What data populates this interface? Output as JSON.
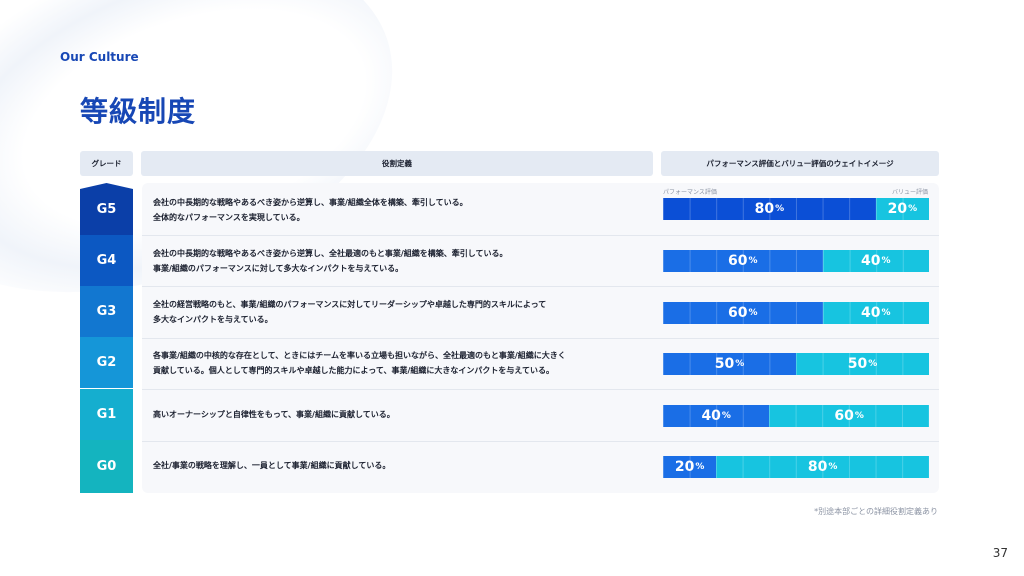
{
  "section_label": "Our Culture",
  "title": "等級制度",
  "headers": {
    "grade": "グレード",
    "role": "役割定義",
    "weight": "パフォーマンス評価とバリュー評価のウェイトイメージ"
  },
  "subheaders": {
    "performance": "パフォーマンス評価",
    "value": "バリュー評価"
  },
  "rows": [
    {
      "grade": "G5",
      "role": "会社の中長期的な戦略やあるべき姿から逆算し、事業/組織全体を構築、牽引している。\n全体的なパフォーマンスを実現している。",
      "performance": 80,
      "value": 20,
      "performance_label": "80",
      "value_label": "20"
    },
    {
      "grade": "G4",
      "role": "会社の中長期的な戦略やあるべき姿から逆算し、全社最適のもと事業/組織を構築、牽引している。\n事業/組織のパフォーマンスに対して多大なインパクトを与えている。",
      "performance": 60,
      "value": 40,
      "performance_label": "60",
      "value_label": "40"
    },
    {
      "grade": "G3",
      "role": "全社の経営戦略のもと、事業/組織のパフォーマンスに対してリーダーシップや卓越した専門的スキルによって\n多大なインパクトを与えている。",
      "performance": 60,
      "value": 40,
      "performance_label": "60",
      "value_label": "40"
    },
    {
      "grade": "G2",
      "role": "各事業/組織の中核的な存在として、ときにはチームを率いる立場も担いながら、全社最適のもと事業/組織に大きく\n貢献している。個人として専門的スキルや卓越した能力によって、事業/組織に大きなインパクトを与えている。",
      "performance": 50,
      "value": 50,
      "performance_label": "50",
      "value_label": "50"
    },
    {
      "grade": "G1",
      "role": "高いオーナーシップと自律性をもって、事業/組織に貢献している。",
      "performance": 40,
      "value": 60,
      "performance_label": "40",
      "value_label": "60"
    },
    {
      "grade": "G0",
      "role": "全社/事業の戦略を理解し、一員として事業/組織に貢献している。",
      "performance": 20,
      "value": 80,
      "performance_label": "20",
      "value_label": "80"
    }
  ],
  "percent_symbol": "%",
  "footnote": "*別途本部ごとの詳細役割定義あり",
  "page_number": "37",
  "colors": {
    "brand": "#1747b5",
    "performance": "#0b4fd6",
    "value": "#17c4e0"
  }
}
